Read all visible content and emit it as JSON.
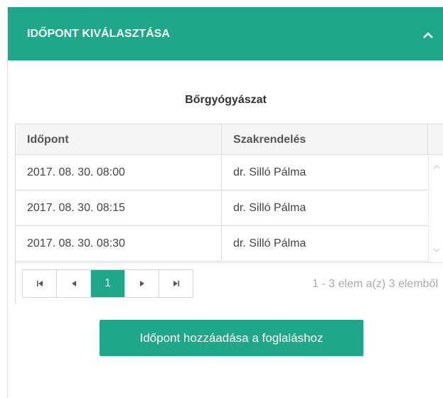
{
  "panel": {
    "title": "IDŐPONT KIVÁLASZTÁSA",
    "accent_color": "#1ea788",
    "collapse_icon": "chevron-up-icon"
  },
  "subtitle": "Bőrgyógyászat",
  "grid": {
    "columns": [
      "Időpont",
      "Szakrendelés"
    ],
    "rows": [
      {
        "time": "2017. 08. 30. 08:00",
        "doctor": "dr. Silló Pálma"
      },
      {
        "time": "2017. 08. 30. 08:15",
        "doctor": "dr. Silló Pálma"
      },
      {
        "time": "2017. 08. 30. 08:30",
        "doctor": "dr. Silló Pálma"
      }
    ]
  },
  "pager": {
    "first_icon": "first-page-icon",
    "prev_icon": "previous-page-icon",
    "current_page": "1",
    "next_icon": "next-page-icon",
    "last_icon": "last-page-icon",
    "info": "1 - 3 elem a(z) 3 elemből"
  },
  "add_button_label": "Időpont hozzáadása a foglaláshoz"
}
